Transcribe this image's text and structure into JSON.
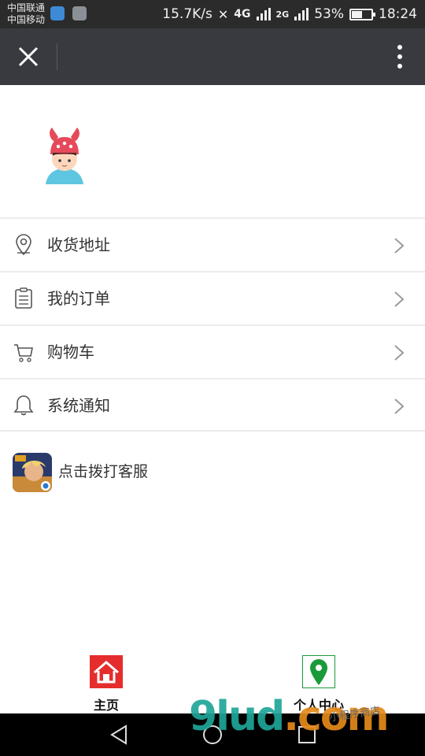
{
  "status_bar": {
    "carrier1": "中国联通",
    "carrier2": "中国移动",
    "speed": "15.7K/s",
    "net1": "4G",
    "net2": "2G",
    "battery": "53%",
    "battery_level": 0.53,
    "time": "18:24"
  },
  "menu": [
    {
      "label": "收货地址",
      "icon": "location-pin-icon"
    },
    {
      "label": "我的订单",
      "icon": "clipboard-icon"
    },
    {
      "label": "购物车",
      "icon": "cart-icon"
    },
    {
      "label": "系统通知",
      "icon": "bell-icon"
    }
  ],
  "service": {
    "label": "点击拨打客服",
    "icon": "game-app-icon"
  },
  "tabs": [
    {
      "label": "主页",
      "icon": "home-icon",
      "color": "#e52d2d"
    },
    {
      "label": "个人中心",
      "icon": "map-pin-icon",
      "color": "#1a9a3a"
    }
  ],
  "watermark": {
    "text": "9lud",
    "suffix": ".com",
    "tag": "小程序商店"
  }
}
